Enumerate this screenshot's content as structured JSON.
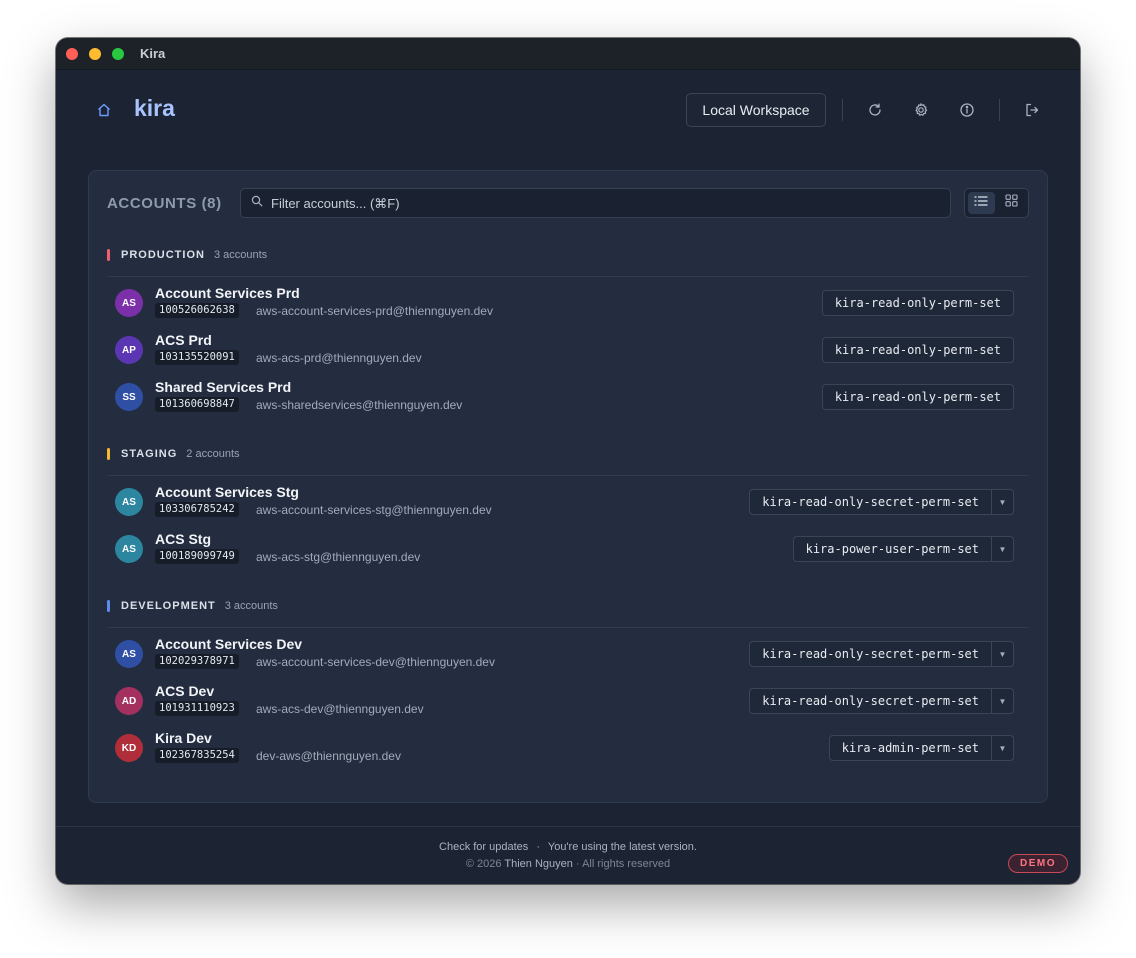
{
  "window": {
    "title": "Kira"
  },
  "header": {
    "brand": "kira",
    "workspace_label": "Local Workspace"
  },
  "accounts": {
    "title": "ACCOUNTS (8)",
    "filter_placeholder": "Filter accounts... (⌘F)",
    "groups": [
      {
        "name": "PRODUCTION",
        "count": "3 accounts",
        "color": "#f0606e",
        "rows": [
          {
            "initials": "AS",
            "avatar_color": "#7b2fa8",
            "name": "Account Services Prd",
            "id": "100526062638",
            "email": "aws-account-services-prd@thiennguyen.dev",
            "perm": "kira-read-only-perm-set",
            "dropdown": false
          },
          {
            "initials": "AP",
            "avatar_color": "#5b36b2",
            "name": "ACS Prd",
            "id": "103135520091",
            "email": "aws-acs-prd@thiennguyen.dev",
            "perm": "kira-read-only-perm-set",
            "dropdown": false
          },
          {
            "initials": "SS",
            "avatar_color": "#2e4fa3",
            "name": "Shared Services Prd",
            "id": "101360698847",
            "email": "aws-sharedservices@thiennguyen.dev",
            "perm": "kira-read-only-perm-set",
            "dropdown": false
          }
        ]
      },
      {
        "name": "STAGING",
        "count": "2 accounts",
        "color": "#f5b82e",
        "rows": [
          {
            "initials": "AS",
            "avatar_color": "#2d86a0",
            "name": "Account Services Stg",
            "id": "103306785242",
            "email": "aws-account-services-stg@thiennguyen.dev",
            "perm": "kira-read-only-secret-perm-set",
            "dropdown": true
          },
          {
            "initials": "AS",
            "avatar_color": "#2d86a0",
            "name": "ACS Stg",
            "id": "100189099749",
            "email": "aws-acs-stg@thiennguyen.dev",
            "perm": "kira-power-user-perm-set",
            "dropdown": true
          }
        ]
      },
      {
        "name": "DEVELOPMENT",
        "count": "3 accounts",
        "color": "#5b8def",
        "rows": [
          {
            "initials": "AS",
            "avatar_color": "#2e4fa3",
            "name": "Account Services Dev",
            "id": "102029378971",
            "email": "aws-account-services-dev@thiennguyen.dev",
            "perm": "kira-read-only-secret-perm-set",
            "dropdown": true
          },
          {
            "initials": "AD",
            "avatar_color": "#a3305e",
            "name": "ACS Dev",
            "id": "101931110923",
            "email": "aws-acs-dev@thiennguyen.dev",
            "perm": "kira-read-only-secret-perm-set",
            "dropdown": true
          },
          {
            "initials": "KD",
            "avatar_color": "#b02e3a",
            "name": "Kira Dev",
            "id": "102367835254",
            "email": "dev-aws@thiennguyen.dev",
            "perm": "kira-admin-perm-set",
            "dropdown": true
          }
        ]
      }
    ]
  },
  "footer": {
    "check_updates": "Check for updates",
    "separator": "·",
    "status": "You're using the latest version.",
    "copyright_prefix": "© 2026",
    "owner": "Thien Nguyen",
    "rights": "· All rights reserved",
    "demo_badge": "DEMO"
  },
  "icons": {
    "home": "home-icon",
    "refresh": "refresh-icon",
    "settings": "gear-icon",
    "info": "info-icon",
    "logout": "logout-icon",
    "search": "search-icon",
    "list_view": "list-view-icon",
    "grid_view": "grid-view-icon"
  }
}
